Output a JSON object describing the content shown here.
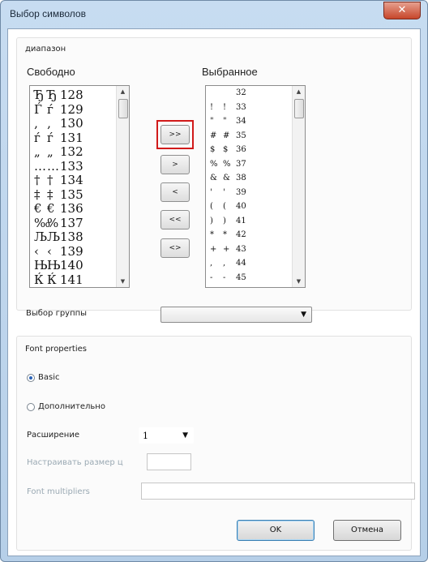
{
  "window": {
    "title": "Выбор символов",
    "close_glyph": "✕"
  },
  "range_group": {
    "label": "диапазон"
  },
  "free": {
    "label": "Свободно",
    "rows": [
      {
        "g1": "Ђ",
        "g2": "Ђ",
        "code": "128"
      },
      {
        "g1": "Ѓ",
        "g2": "ѓ",
        "code": "129"
      },
      {
        "g1": "‚",
        "g2": "‚",
        "code": "130"
      },
      {
        "g1": "ѓ",
        "g2": "ѓ",
        "code": "131"
      },
      {
        "g1": "„",
        "g2": "„",
        "code": "132"
      },
      {
        "g1": "…",
        "g2": "…",
        "code": "133"
      },
      {
        "g1": "†",
        "g2": "†",
        "code": "134"
      },
      {
        "g1": "‡",
        "g2": "‡",
        "code": "135"
      },
      {
        "g1": "€",
        "g2": "€",
        "code": "136"
      },
      {
        "g1": "‰",
        "g2": "%",
        "code": "137"
      },
      {
        "g1": "Љ",
        "g2": "Љ",
        "code": "138"
      },
      {
        "g1": "‹",
        "g2": "‹",
        "code": "139"
      },
      {
        "g1": "Њ",
        "g2": "Њ",
        "code": "140"
      },
      {
        "g1": "Ќ",
        "g2": "Ќ",
        "code": "141"
      }
    ]
  },
  "selected": {
    "label": "Выбранное",
    "rows": [
      {
        "g1": "",
        "g2": "",
        "code": "32"
      },
      {
        "g1": "!",
        "g2": "!",
        "code": "33"
      },
      {
        "g1": "\"",
        "g2": "\"",
        "code": "34"
      },
      {
        "g1": "#",
        "g2": "#",
        "code": "35"
      },
      {
        "g1": "$",
        "g2": "$",
        "code": "36"
      },
      {
        "g1": "%",
        "g2": "%",
        "code": "37"
      },
      {
        "g1": "&",
        "g2": "&",
        "code": "38"
      },
      {
        "g1": "'",
        "g2": "'",
        "code": "39"
      },
      {
        "g1": "(",
        "g2": "(",
        "code": "40"
      },
      {
        "g1": ")",
        "g2": ")",
        "code": "41"
      },
      {
        "g1": "*",
        "g2": "*",
        "code": "42"
      },
      {
        "g1": "+",
        "g2": "+",
        "code": "43"
      },
      {
        "g1": ",",
        "g2": ",",
        "code": "44"
      },
      {
        "g1": "-",
        "g2": "-",
        "code": "45"
      }
    ]
  },
  "move_buttons": {
    "add_all": ">>",
    "add": ">",
    "remove": "<",
    "remove_all": "<<",
    "swap": "<>"
  },
  "group_select": {
    "label": "Выбор группы",
    "value": ""
  },
  "font_properties": {
    "label": "Font properties",
    "radio_basic": "Basic",
    "radio_advanced": "Дополнительно",
    "selected_radio": "Basic",
    "extension_label": "Расширение",
    "extension_value": "1",
    "size_label": "Настраивать размер ц",
    "size_value": "",
    "multipliers_label": "Font multipliers",
    "multipliers_value": ""
  },
  "buttons": {
    "ok": "OK",
    "cancel": "Отмена"
  },
  "colors": {
    "highlight": "#d11a1a",
    "radio_dot": "#2a63b8"
  }
}
